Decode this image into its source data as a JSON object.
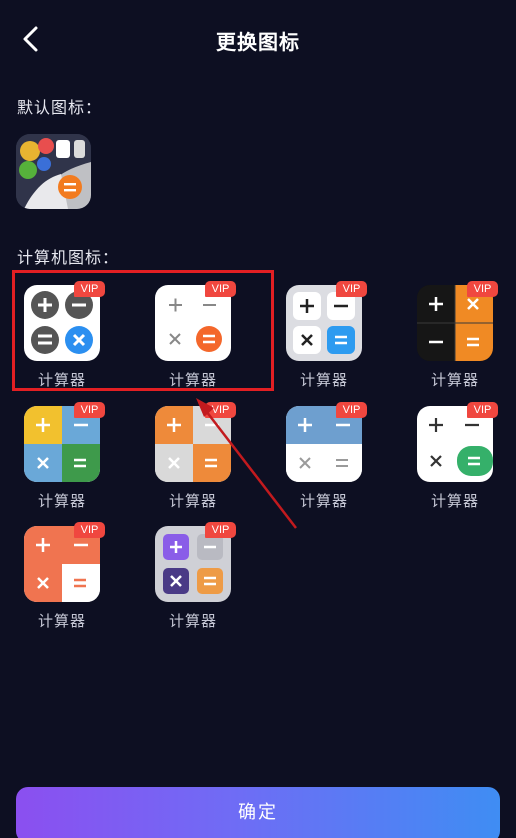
{
  "header": {
    "title": "更换图标",
    "back_icon": "chevron-left-icon"
  },
  "default_section": {
    "label": "默认图标：",
    "icon": "default-app-icon"
  },
  "calculator_section": {
    "label": "计算机图标：",
    "items": [
      {
        "label": "计算器",
        "badge": "VIP",
        "style": "round-gray-blue"
      },
      {
        "label": "计算器",
        "badge": "VIP",
        "style": "white-orange-circle"
      },
      {
        "label": "计算器",
        "badge": "VIP",
        "style": "light-tiles-blue"
      },
      {
        "label": "计算器",
        "badge": "VIP",
        "style": "black-orange-quad"
      },
      {
        "label": "计算器",
        "badge": "VIP",
        "style": "yellow-blue-green-quad"
      },
      {
        "label": "计算器",
        "badge": "VIP",
        "style": "orange-gray-quad"
      },
      {
        "label": "计算器",
        "badge": "VIP",
        "style": "blue-white-quad"
      },
      {
        "label": "计算器",
        "badge": "VIP",
        "style": "white-green-tab"
      },
      {
        "label": "计算器",
        "badge": "VIP",
        "style": "coral-white-quad"
      },
      {
        "label": "计算器",
        "badge": "VIP",
        "style": "purple-gray-tiles"
      }
    ]
  },
  "confirm_button": {
    "label": "确定"
  },
  "colors": {
    "background": "#0d0f22",
    "vip_badge": "#f0473f",
    "highlight_box": "#e21f23",
    "button_gradient_start": "#8b4ff0",
    "button_gradient_end": "#3f8df3"
  }
}
